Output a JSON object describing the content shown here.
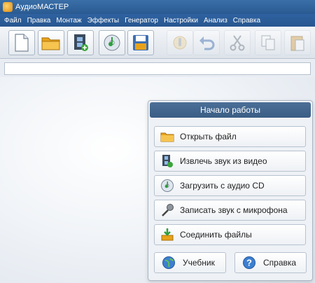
{
  "window": {
    "title": "АудиоМАСТЕР"
  },
  "menu": {
    "items": [
      {
        "label": "Файл"
      },
      {
        "label": "Правка"
      },
      {
        "label": "Монтаж"
      },
      {
        "label": "Эффекты"
      },
      {
        "label": "Генератор"
      },
      {
        "label": "Настройки"
      },
      {
        "label": "Анализ"
      },
      {
        "label": "Справка"
      }
    ]
  },
  "toolbar": {
    "buttons": [
      {
        "icon": "new-file-icon",
        "enabled": true
      },
      {
        "icon": "open-folder-icon",
        "enabled": true
      },
      {
        "icon": "video-film-icon",
        "enabled": true
      },
      {
        "icon": "audio-cd-icon",
        "enabled": true
      },
      {
        "icon": "save-floppy-icon",
        "enabled": true
      },
      {
        "icon": "microphone-icon",
        "enabled": false
      },
      {
        "icon": "undo-icon",
        "enabled": false
      },
      {
        "icon": "cut-scissors-icon",
        "enabled": false
      },
      {
        "icon": "copy-icon",
        "enabled": false
      },
      {
        "icon": "paste-icon",
        "enabled": false
      }
    ]
  },
  "start_panel": {
    "title": "Начало работы",
    "actions": [
      {
        "label": "Открыть файл",
        "icon": "open-folder-icon"
      },
      {
        "label": "Извлечь звук из видео",
        "icon": "video-film-icon"
      },
      {
        "label": "Загрузить с аудио CD",
        "icon": "audio-cd-icon"
      },
      {
        "label": "Записать звук с микрофона",
        "icon": "microphone-icon"
      },
      {
        "label": "Соединить файлы",
        "icon": "merge-files-icon"
      }
    ],
    "tutorial_label": "Учебник",
    "help_label": "Справка"
  },
  "colors": {
    "title_bar": "#2f62a0",
    "panel_header": "#44688f",
    "accent": "#e8a21a"
  }
}
